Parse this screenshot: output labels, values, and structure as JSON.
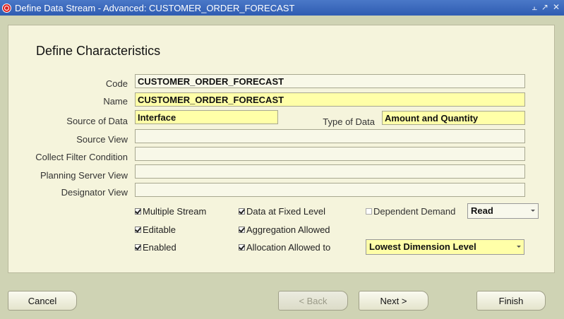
{
  "window": {
    "title": "Define Data Stream - Advanced: CUSTOMER_ORDER_FORECAST"
  },
  "heading": "Define Characteristics",
  "fields": {
    "code": {
      "label": "Code",
      "value": "CUSTOMER_ORDER_FORECAST"
    },
    "name": {
      "label": "Name",
      "value": "CUSTOMER_ORDER_FORECAST"
    },
    "source_of_data": {
      "label": "Source of Data",
      "value": "Interface"
    },
    "type_of_data": {
      "label": "Type of Data",
      "value": "Amount and Quantity"
    },
    "source_view": {
      "label": "Source View",
      "value": ""
    },
    "collect_filter": {
      "label": "Collect Filter Condition",
      "value": ""
    },
    "planning_server_view": {
      "label": "Planning Server View",
      "value": ""
    },
    "designator_view": {
      "label": "Designator View",
      "value": ""
    }
  },
  "checkboxes": {
    "multiple_stream": {
      "label": "Multiple Stream",
      "checked": true
    },
    "editable": {
      "label": "Editable",
      "checked": true
    },
    "enabled": {
      "label": "Enabled",
      "checked": true
    },
    "data_fixed_level": {
      "label": "Data at Fixed Level",
      "checked": true
    },
    "aggregation_allowed": {
      "label": "Aggregation Allowed",
      "checked": true
    },
    "allocation_allowed": {
      "label": "Allocation Allowed to",
      "checked": true
    },
    "dependent_demand": {
      "label": "Dependent Demand",
      "checked": false
    }
  },
  "selects": {
    "dependent_demand_mode": "Read",
    "allocation_level": "Lowest Dimension Level"
  },
  "buttons": {
    "cancel": "Cancel",
    "back": "< Back",
    "next": "Next >",
    "finish": "Finish"
  },
  "colors": {
    "required_field": "#ffffa8",
    "panel": "#f5f4dc",
    "titlebar": "#2f5cb2"
  }
}
